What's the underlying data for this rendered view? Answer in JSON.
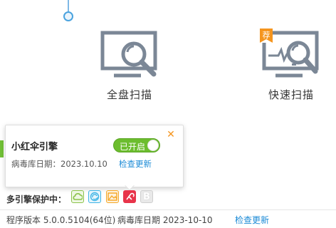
{
  "scan": {
    "full": {
      "label": "全盘扫描",
      "icon": "monitor-magnifier-icon"
    },
    "quick": {
      "label": "快速扫描",
      "icon": "monitor-pulse-magnifier-icon",
      "badge": "荐"
    }
  },
  "engine_popup": {
    "name": "小红伞引擎",
    "toggle_label": "已开启",
    "toggle_on": true,
    "virus_db": "病毒库日期：2023.10.10",
    "check_update": "检查更新",
    "close_icon": "close-icon"
  },
  "engines": {
    "label": "多引擎保护中：",
    "items": [
      {
        "name": "cloud-engine-icon",
        "color": "#8bc34a"
      },
      {
        "name": "qvm-engine-icon",
        "color": "#3db4e6"
      },
      {
        "name": "image-engine-icon",
        "color": "#f5a623"
      },
      {
        "name": "avira-umbrella-engine-icon",
        "color": "#e8344a"
      },
      {
        "name": "bitdefender-engine-icon",
        "color": "#c8c8c8"
      }
    ]
  },
  "footer": {
    "version": "程序版本 5.0.0.5104(64位)",
    "virus_db": "病毒库日期 2023-10-10",
    "check_update": "检查更新"
  },
  "colors": {
    "accent_blue": "#1a8ad6",
    "toggle_green": "#6cbd2e",
    "icon_gray": "#7b8796",
    "close_orange": "#f5951e"
  }
}
